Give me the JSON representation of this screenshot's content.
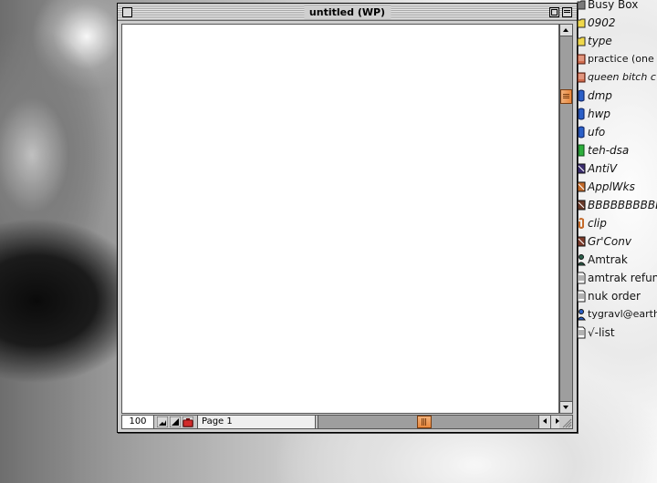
{
  "window": {
    "title": "untitled (WP)",
    "scroll": {
      "vertical_position": 0.15,
      "horizontal_position": 0.48
    }
  },
  "bottom_bar": {
    "zoom": "100",
    "page": "Page 1"
  },
  "desktop_items": [
    {
      "label": "Busy Box",
      "italic": false,
      "icon": "folder-icon",
      "color": "#7b7b7b"
    },
    {
      "label": "0902",
      "italic": true,
      "icon": "alias-folder-icon",
      "color": "#f0d84a"
    },
    {
      "label": "type",
      "italic": true,
      "icon": "alias-folder-icon",
      "color": "#f0d84a"
    },
    {
      "label": "practice (one",
      "italic": false,
      "icon": "stack-icon",
      "color": "#d26c4e"
    },
    {
      "label": "queen bitch c",
      "italic": true,
      "icon": "stack-icon",
      "color": "#d26c4e"
    },
    {
      "label": "dmp",
      "italic": true,
      "icon": "disk-icon",
      "color": "#2b5fc7"
    },
    {
      "label": "hwp",
      "italic": true,
      "icon": "disk-icon",
      "color": "#2b5fc7"
    },
    {
      "label": "ufo",
      "italic": true,
      "icon": "disk-icon",
      "color": "#2b5fc7"
    },
    {
      "label": "teh-dsa",
      "italic": true,
      "icon": "green-doc-icon",
      "color": "#2cae3b"
    },
    {
      "label": "AntiV",
      "italic": true,
      "icon": "app-icon",
      "color": "#3a2c6e"
    },
    {
      "label": "ApplWks",
      "italic": true,
      "icon": "app-icon",
      "color": "#c46a2a"
    },
    {
      "label": "BBBBBBBBBBB",
      "italic": true,
      "icon": "app-icon",
      "color": "#6b3b2a"
    },
    {
      "label": "clip",
      "italic": true,
      "icon": "clip-icon",
      "color": "#c46a2a"
    },
    {
      "label": "Gr'Conv",
      "italic": true,
      "icon": "app-icon",
      "color": "#7b3a2a"
    },
    {
      "label": "Amtrak",
      "italic": false,
      "icon": "person-icon",
      "color": "#2b5f4a"
    },
    {
      "label": "amtrak refun",
      "italic": false,
      "icon": "document-icon",
      "color": "#ffffff"
    },
    {
      "label": "nuk order",
      "italic": false,
      "icon": "document-icon",
      "color": "#ffffff"
    },
    {
      "label": "tygravl@earthlin",
      "italic": false,
      "icon": "person-icon",
      "color": "#2b5fc7"
    },
    {
      "label": "√-list",
      "italic": false,
      "icon": "document-icon",
      "color": "#ffffff"
    }
  ]
}
